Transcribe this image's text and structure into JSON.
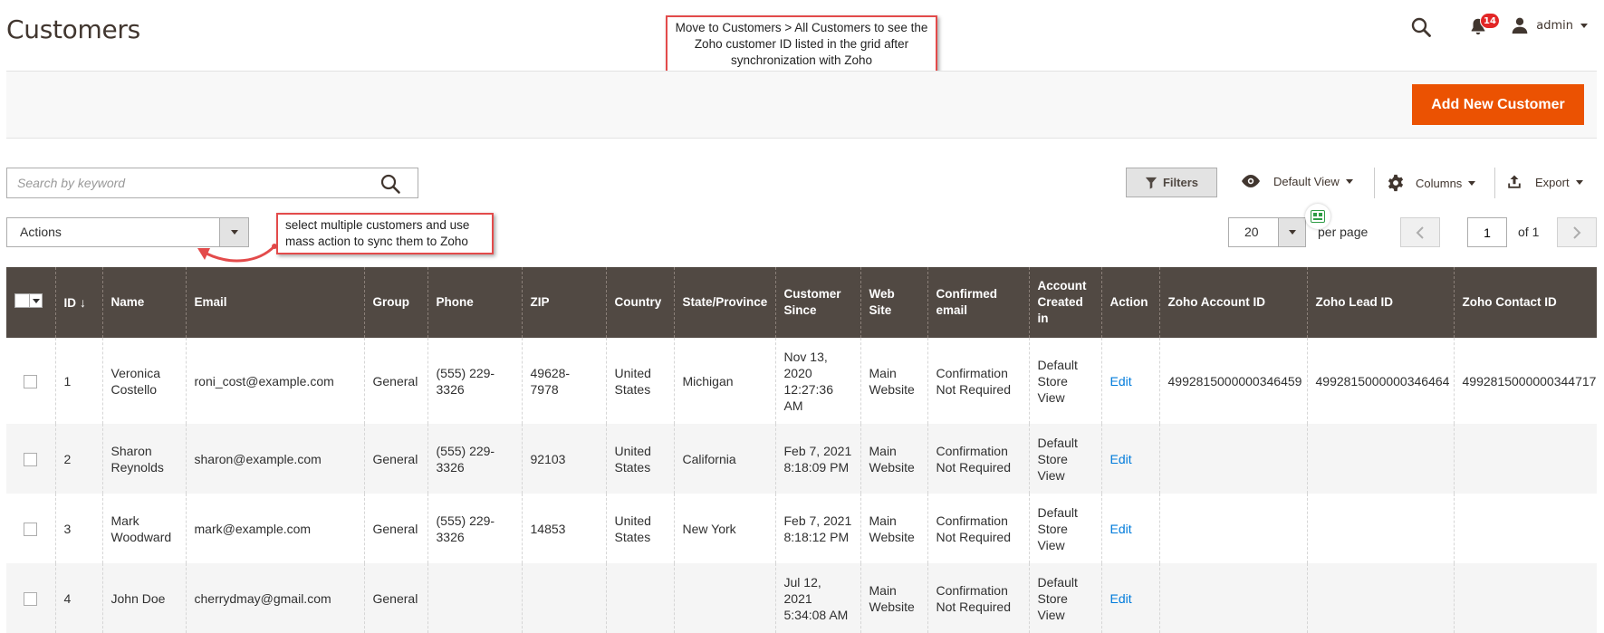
{
  "header": {
    "page_title": "Customers",
    "notification_count": "14",
    "user_name": "admin"
  },
  "annotations": {
    "top_note": "Move to Customers > All Customers to see the Zoho customer ID listed in the grid after synchronization with Zoho",
    "actions_note": "select multiple customers and use mass action to sync them to Zoho"
  },
  "toolbar": {
    "add_button_label": "Add New Customer",
    "search_placeholder": "Search by keyword",
    "filters_label": "Filters",
    "view_label": "Default View",
    "columns_label": "Columns",
    "export_label": "Export",
    "actions_label": "Actions",
    "per_page_value": "20",
    "per_page_label": "per page",
    "current_page": "1",
    "page_total_label": "of 1"
  },
  "colors": {
    "accent": "#eb5202",
    "header_bg": "#514943",
    "link": "#007bdb",
    "callout_border": "#e34b4b"
  },
  "table": {
    "columns": [
      "ID",
      "Name",
      "Email",
      "Group",
      "Phone",
      "ZIP",
      "Country",
      "State/Province",
      "Customer Since",
      "Web Site",
      "Confirmed email",
      "Account Created in",
      "Action",
      "Zoho Account ID",
      "Zoho Lead ID",
      "Zoho Contact ID"
    ],
    "sort_indicator": "↓",
    "rows": [
      {
        "id": "1",
        "name": "Veronica Costello",
        "email": "roni_cost@example.com",
        "group": "General",
        "phone": "(555) 229-3326",
        "zip": "49628-7978",
        "country": "United States",
        "state": "Michigan",
        "since": "Nov 13, 2020 12:27:36 AM",
        "website": "Main Website",
        "confirmed": "Confirmation Not Required",
        "created_in": "Default Store View",
        "action": "Edit",
        "zoho_account": "4992815000000346459",
        "zoho_lead": "4992815000000346464",
        "zoho_contact": "4992815000000344717"
      },
      {
        "id": "2",
        "name": "Sharon Reynolds",
        "email": "sharon@example.com",
        "group": "General",
        "phone": "(555) 229-3326",
        "zip": "92103",
        "country": "United States",
        "state": "California",
        "since": "Feb 7, 2021 8:18:09 PM",
        "website": "Main Website",
        "confirmed": "Confirmation Not Required",
        "created_in": "Default Store View",
        "action": "Edit",
        "zoho_account": "",
        "zoho_lead": "",
        "zoho_contact": ""
      },
      {
        "id": "3",
        "name": "Mark Woodward",
        "email": "mark@example.com",
        "group": "General",
        "phone": "(555) 229-3326",
        "zip": "14853",
        "country": "United States",
        "state": "New York",
        "since": "Feb 7, 2021 8:18:12 PM",
        "website": "Main Website",
        "confirmed": "Confirmation Not Required",
        "created_in": "Default Store View",
        "action": "Edit",
        "zoho_account": "",
        "zoho_lead": "",
        "zoho_contact": ""
      },
      {
        "id": "4",
        "name": "John Doe",
        "email": "cherrydmay@gmail.com",
        "group": "General",
        "phone": "",
        "zip": "",
        "country": "",
        "state": "",
        "since": "Jul 12, 2021 5:34:08 AM",
        "website": "Main Website",
        "confirmed": "Confirmation Not Required",
        "created_in": "Default Store View",
        "action": "Edit",
        "zoho_account": "",
        "zoho_lead": "",
        "zoho_contact": ""
      }
    ]
  }
}
